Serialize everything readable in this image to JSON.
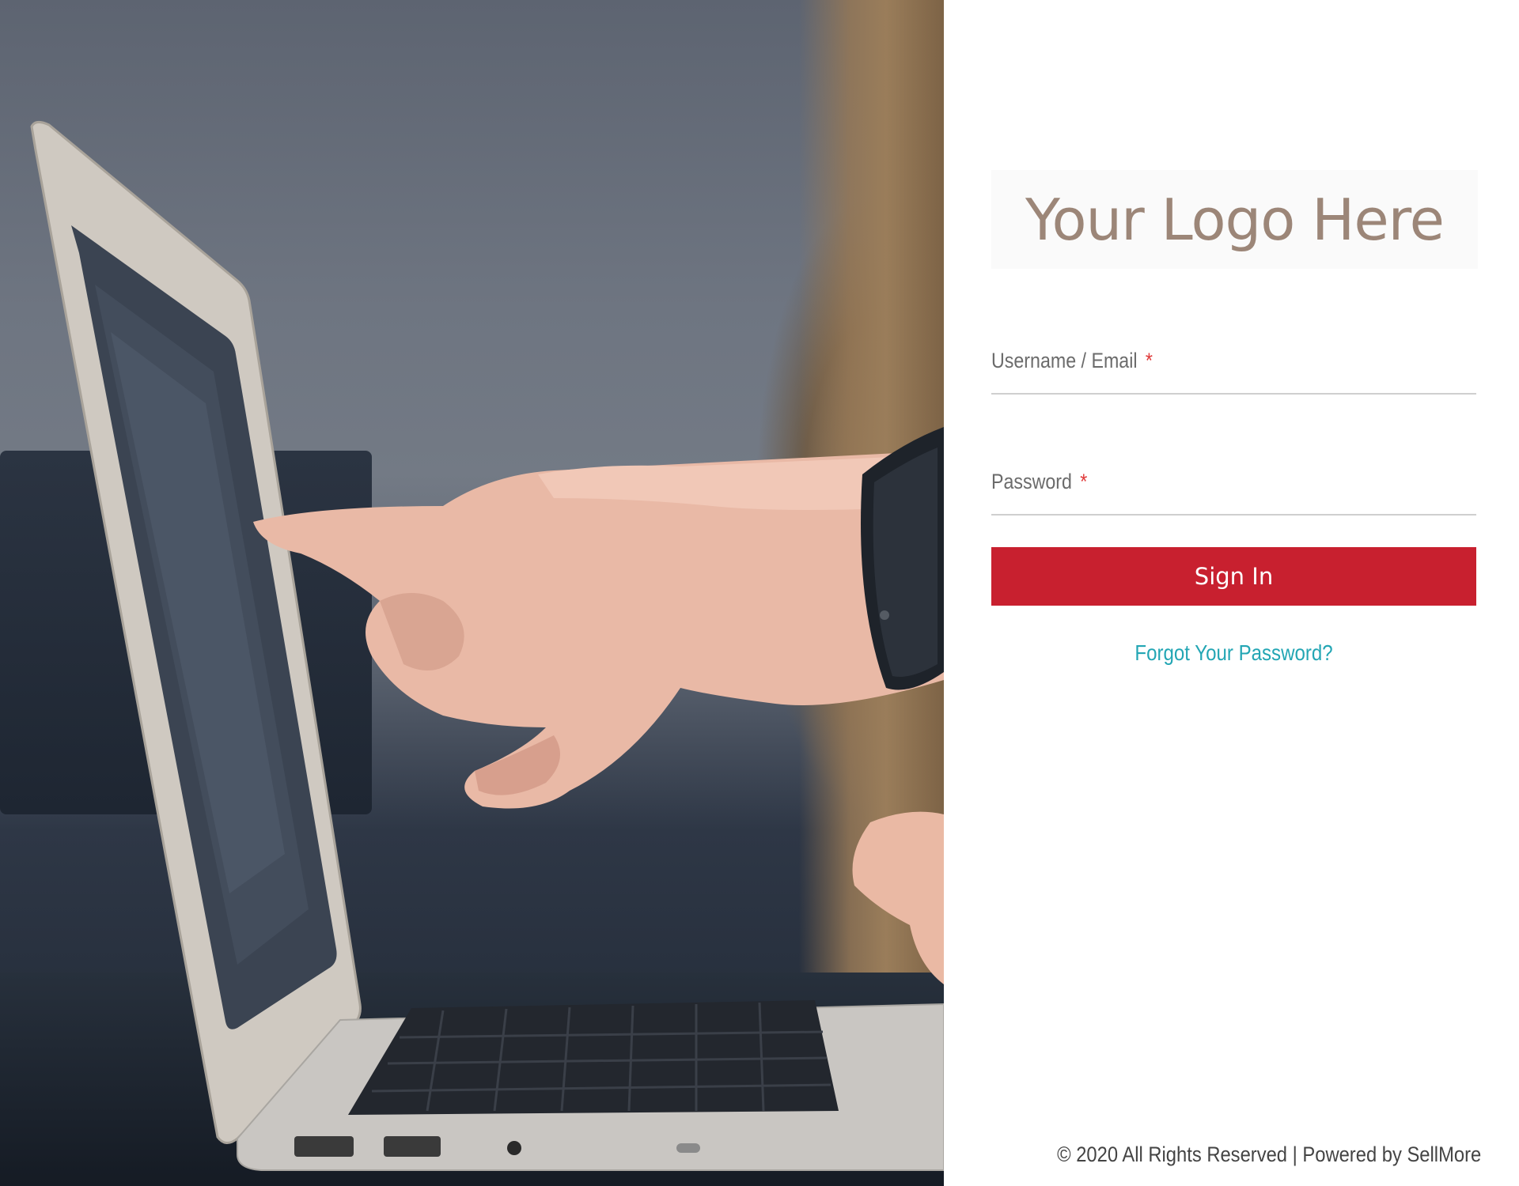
{
  "hero": {
    "image_description_icon": "laptop-photo"
  },
  "login": {
    "logo_text": "Your Logo Here",
    "username_label": "Username / Email",
    "password_label": "Password",
    "required_marker": "*",
    "username_value": "",
    "password_value": "",
    "signin_label": "Sign In",
    "forgot_label": "Forgot Your Password?"
  },
  "footer": {
    "text": "© 2020 All Rights Reserved | Powered by SellMore"
  },
  "colors": {
    "accent": "#c8202f",
    "link": "#23a6b4",
    "logo": "#9c8678",
    "required": "#e03a3a"
  }
}
